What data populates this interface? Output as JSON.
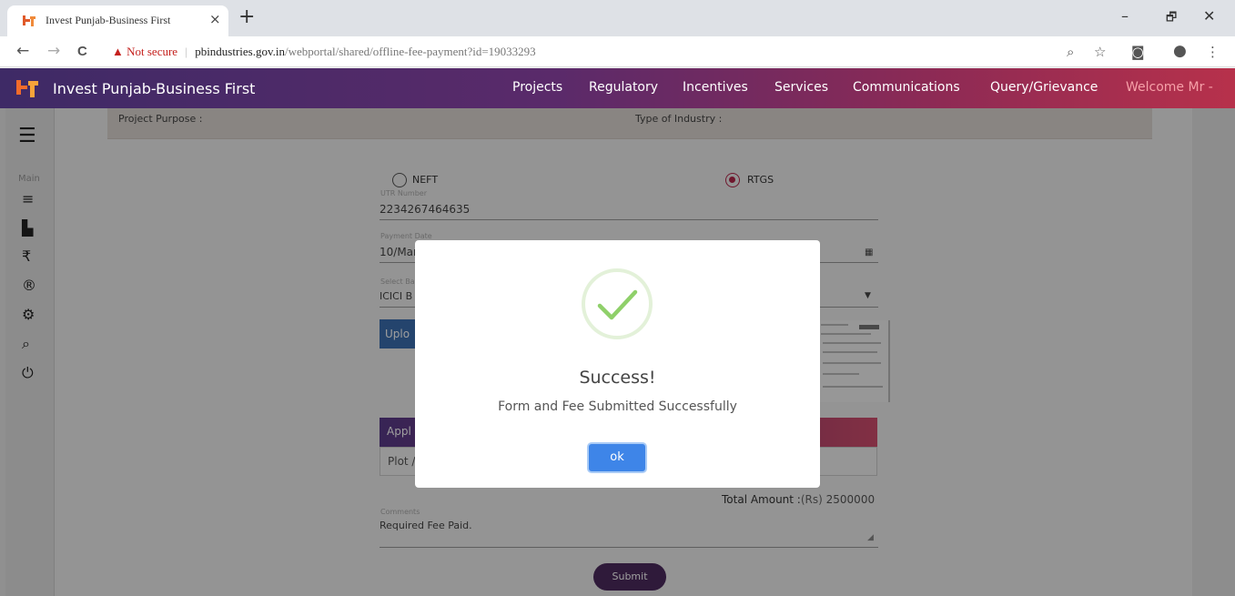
{
  "browser": {
    "tab_title": "Invest Punjab-Business First",
    "tab_close": "×",
    "new_tab": "+",
    "window_controls": {
      "minimize": "–",
      "restore": "🗗",
      "close": "✕"
    },
    "nav": {
      "back": "←",
      "forward": "→",
      "reload": "C"
    },
    "security_warning": "Not secure",
    "url_host": "pbindustries.gov.in",
    "url_path": "/webportal/shared/offline-fee-payment?id=19033293"
  },
  "header": {
    "title": "Invest Punjab-Business First",
    "nav_items": [
      "Projects",
      "Regulatory",
      "Incentives",
      "Services",
      "Communications",
      "Query/Grievance"
    ],
    "welcome": "Welcome Mr -"
  },
  "sidebar": {
    "main_label": "Main"
  },
  "project_bar": {
    "purpose_label": "Project Purpose :",
    "industry_label": "Type of Industry :"
  },
  "form": {
    "neft_label": "NEFT",
    "rtgs_label": "RTGS",
    "utr_label": "UTR Number",
    "utr_value": "2234267464635",
    "payment_date_label": "Payment Date",
    "payment_date_value": "10/Mar",
    "bank_label": "Select Bank",
    "bank_value": "ICICI B",
    "upload_label": "Uplo",
    "applied_header": "Appl",
    "plot_value": "Plot /",
    "total_label": "Total Amount :",
    "total_currency": "(Rs)",
    "total_value": "2500000",
    "comments_label": "Comments",
    "comments_value": "Required Fee Paid.",
    "submit_label": "Submit"
  },
  "modal": {
    "title": "Success!",
    "message": "Form and Fee Submitted Successfully",
    "ok_label": "ok"
  },
  "colors": {
    "header_start": "#3e2a66",
    "header_end": "#b7314b",
    "success_green": "#8fd06a",
    "ok_blue": "#3e85e8",
    "submit_purple": "#4d2b5e"
  }
}
